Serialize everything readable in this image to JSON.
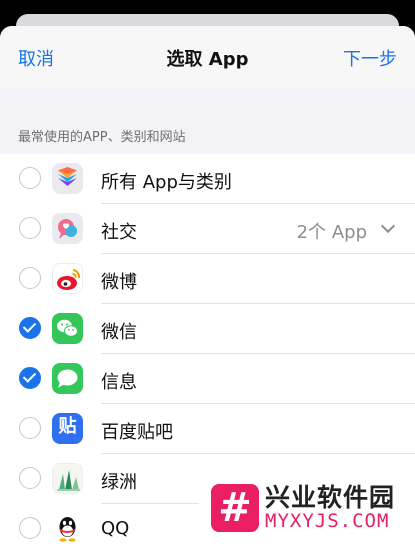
{
  "nav": {
    "cancel": "取消",
    "title": "选取 App",
    "next": "下一步"
  },
  "section_header": "最常使用的APP、类别和网站",
  "items": [
    {
      "label": "所有 App与类别",
      "checked": false,
      "icon": "stack-icon"
    },
    {
      "label": "社交",
      "checked": false,
      "icon": "social-chat-icon",
      "trailing": "2个 App"
    },
    {
      "label": "微博",
      "checked": false,
      "icon": "weibo-icon"
    },
    {
      "label": "微信",
      "checked": true,
      "icon": "wechat-icon"
    },
    {
      "label": "信息",
      "checked": true,
      "icon": "messages-icon"
    },
    {
      "label": "百度贴吧",
      "checked": false,
      "icon": "tieba-icon",
      "icon_text": "贴"
    },
    {
      "label": "绿洲",
      "checked": false,
      "icon": "oasis-icon"
    },
    {
      "label": "QQ",
      "checked": false,
      "icon": "qq-icon"
    }
  ],
  "watermark": {
    "title": "兴业软件园",
    "url": "MYXYJS.COM"
  },
  "colors": {
    "accent": "#1a73e8",
    "background": "#f2f2f7",
    "watermark": "#e91e63"
  }
}
